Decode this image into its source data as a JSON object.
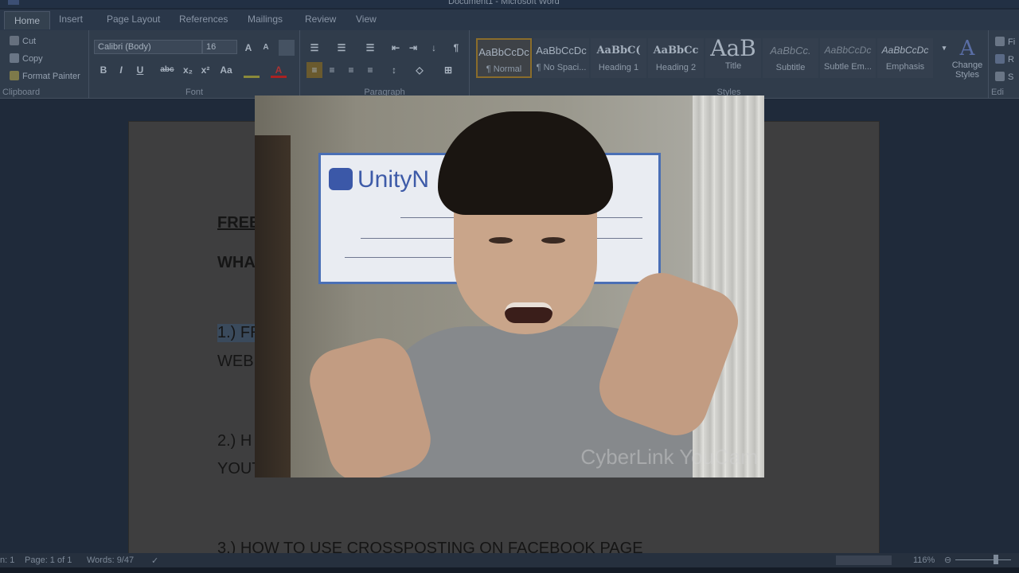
{
  "window": {
    "title": "Document1 - Microsoft Word"
  },
  "tabs": [
    "Home",
    "Insert",
    "Page Layout",
    "References",
    "Mailings",
    "Review",
    "View"
  ],
  "active_tab": "Home",
  "clipboard": {
    "cut": "Cut",
    "copy": "Copy",
    "format_painter": "Format Painter",
    "label": "Clipboard"
  },
  "font": {
    "name": "Calibri (Body)",
    "size": "16",
    "label": "Font",
    "bold": "B",
    "italic": "I",
    "underline": "U",
    "strike": "abc",
    "sub": "x₂",
    "sup": "x²",
    "case": "Aa",
    "grow": "A",
    "shrink": "A"
  },
  "paragraph": {
    "label": "Paragraph",
    "pilcrow": "¶"
  },
  "styles": {
    "label": "Styles",
    "items": [
      {
        "preview": "AaBbCcDc",
        "name": "¶ Normal"
      },
      {
        "preview": "AaBbCcDc",
        "name": "¶ No Spaci..."
      },
      {
        "preview": "AaBbC(",
        "name": "Heading 1"
      },
      {
        "preview": "AaBbCc",
        "name": "Heading 2"
      },
      {
        "preview": "AaB",
        "name": "Title"
      },
      {
        "preview": "AaBbCc.",
        "name": "Subtitle"
      },
      {
        "preview": "AaBbCcDc",
        "name": "Subtle Em..."
      },
      {
        "preview": "AaBbCcDc",
        "name": "Emphasis"
      }
    ],
    "change_styles": "Change Styles"
  },
  "editing": {
    "find": "Fi",
    "replace": "R",
    "select": "S",
    "label": "Edi"
  },
  "document": {
    "lines": [
      "FREE",
      "WHA",
      "1.) FR",
      "WEB",
      "2.) H",
      "YOUT",
      "3.)  HOW TO USE CROSSPOSTING ON FACEBOOK PAGE"
    ]
  },
  "webcam": {
    "cheque_brand": "UnityN",
    "watermark": "CyberLink YouCam"
  },
  "status": {
    "section": "n: 1",
    "page": "Page: 1 of 1",
    "words": "Words: 9/47",
    "zoom": "116%"
  },
  "colors": {
    "accent": "#8a6d2b",
    "highlight": "#3a4a5c",
    "cheque_border": "#4a6fb5"
  }
}
